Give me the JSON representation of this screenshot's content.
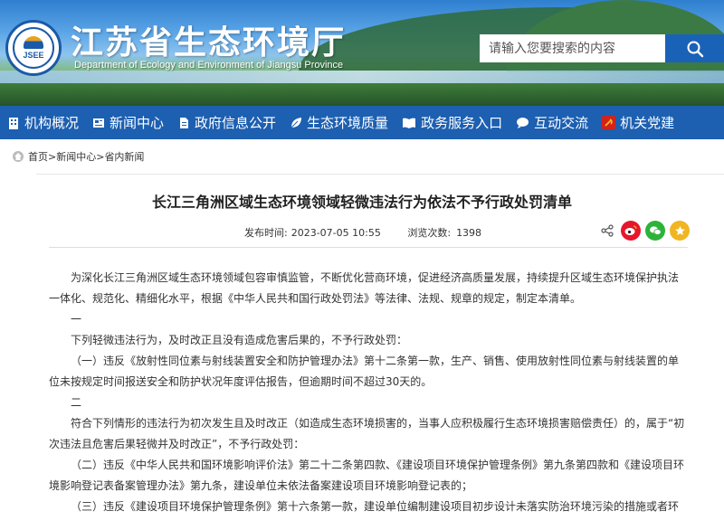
{
  "header": {
    "title": "江苏省生态环境厅",
    "subtitle": "Department of Ecology and Environment of Jiangsu Province",
    "logo_text": "JSEE",
    "search_placeholder": "请输入您要搜索的内容"
  },
  "nav": {
    "items": [
      {
        "label": "机构概况",
        "icon": "building-icon"
      },
      {
        "label": "新闻中心",
        "icon": "news-icon"
      },
      {
        "label": "政府信息公开",
        "icon": "document-icon"
      },
      {
        "label": "生态环境质量",
        "icon": "leaf-icon"
      },
      {
        "label": "政务服务入口",
        "icon": "book-icon"
      },
      {
        "label": "互动交流",
        "icon": "chat-icon"
      },
      {
        "label": "机关党建",
        "icon": "party-emblem-icon"
      }
    ]
  },
  "breadcrumb": {
    "home": "首页",
    "sep": ">",
    "level2": "新闻中心",
    "level3": "省内新闻"
  },
  "article": {
    "title": "长江三角洲区域生态环境领域轻微违法行为依法不予行政处罚清单",
    "publish_label": "发布时间:",
    "publish_time": "2023-07-05 10:55",
    "views_label": "浏览次数:",
    "views": "1398",
    "paragraphs": [
      "为深化长江三角洲区域生态环境领域包容审慎监管，不断优化营商环境，促进经济高质量发展，持续提升区域生态环境保护执法一体化、规范化、精细化水平，根据《中华人民共和国行政处罚法》等法律、法规、规章的规定，制定本清单。",
      "一",
      "下列轻微违法行为，及时改正且没有造成危害后果的，不予行政处罚：",
      "（一）违反《放射性同位素与射线装置安全和防护管理办法》第十二条第一款，生产、销售、使用放射性同位素与射线装置的单位未按规定时间报送安全和防护状况年度评估报告，但逾期时间不超过30天的。",
      "二",
      "符合下列情形的违法行为初次发生且及时改正（如造成生态环境损害的，当事人应积极履行生态环境损害赔偿责任）的，属于“初次违法且危害后果轻微并及时改正”，不予行政处罚：",
      "（二）违反《中华人民共和国环境影响评价法》第二十二条第四款、《建设项目环境保护管理条例》第九条第四款和《建设项目环境影响登记表备案管理办法》第九条，建设单位未依法备案建设项目环境影响登记表的；",
      "（三）违反《建设项目环境保护管理条例》第十六条第一款，建设单位编制建设项目初步设计未落实防治环境污染的措施或者环"
    ]
  },
  "colors": {
    "nav_bg": "#1d5fb0",
    "search_btn": "#1a62b8",
    "weibo": "#e6162d",
    "wechat": "#2db33a",
    "favorite": "#f0b521"
  }
}
